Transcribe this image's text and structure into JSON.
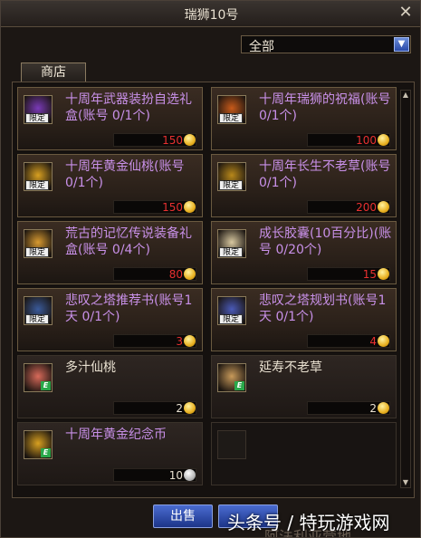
{
  "window": {
    "title": "瑞狮10号"
  },
  "filter": {
    "selected": "全部"
  },
  "tabs": [
    {
      "label": "商店"
    }
  ],
  "badges": {
    "limited": "限定",
    "equip": "E"
  },
  "items": [
    {
      "name": "十周年武器装扮自选礼盒(账号 0/1个)",
      "price": "150",
      "currency": "gold",
      "limited": true,
      "icon": "weapon-box-icon",
      "color": "#c890e8"
    },
    {
      "name": "十周年瑞狮的祝福(账号 0/1个)",
      "price": "100",
      "currency": "gold",
      "limited": true,
      "icon": "lion-blessing-icon",
      "color": "#c890e8"
    },
    {
      "name": "十周年黄金仙桃(账号 0/1个)",
      "price": "150",
      "currency": "gold",
      "limited": true,
      "icon": "golden-peach-icon",
      "color": "#c890e8"
    },
    {
      "name": "十周年长生不老草(账号 0/1个)",
      "price": "200",
      "currency": "gold",
      "limited": true,
      "icon": "immortal-herb-icon",
      "color": "#c890e8"
    },
    {
      "name": "荒古的记忆传说装备礼盒(账号 0/4个)",
      "price": "80",
      "currency": "gold",
      "limited": true,
      "icon": "legendary-box-icon",
      "color": "#c890e8"
    },
    {
      "name": "成长胶囊(10百分比)(账号 0/20个)",
      "price": "15",
      "currency": "gold",
      "limited": true,
      "icon": "growth-capsule-icon",
      "color": "#c890e8"
    },
    {
      "name": "悲叹之塔推荐书(账号1天 0/1个)",
      "price": "3",
      "currency": "gold",
      "limited": true,
      "icon": "tower-recommend-book-icon",
      "color": "#c890e8"
    },
    {
      "name": "悲叹之塔规划书(账号1天 0/1个)",
      "price": "4",
      "currency": "gold",
      "limited": true,
      "icon": "tower-plan-book-icon",
      "color": "#c890e8"
    },
    {
      "name": "多汁仙桃",
      "price": "2",
      "currency": "gold",
      "limited": false,
      "icon": "juicy-peach-icon",
      "color": "#e8e0d0"
    },
    {
      "name": "延寿不老草",
      "price": "2",
      "currency": "gold",
      "limited": false,
      "icon": "longevity-herb-icon",
      "color": "#e8e0d0"
    },
    {
      "name": "十周年黄金纪念币",
      "price": "10",
      "currency": "silver",
      "limited": false,
      "icon": "gold-coin-icon",
      "color": "#c890e8"
    }
  ],
  "background_text": "阿法利亚营地",
  "buttons": {
    "sell": "出售"
  },
  "watermark": "头条号 / 特玩游戏网"
}
